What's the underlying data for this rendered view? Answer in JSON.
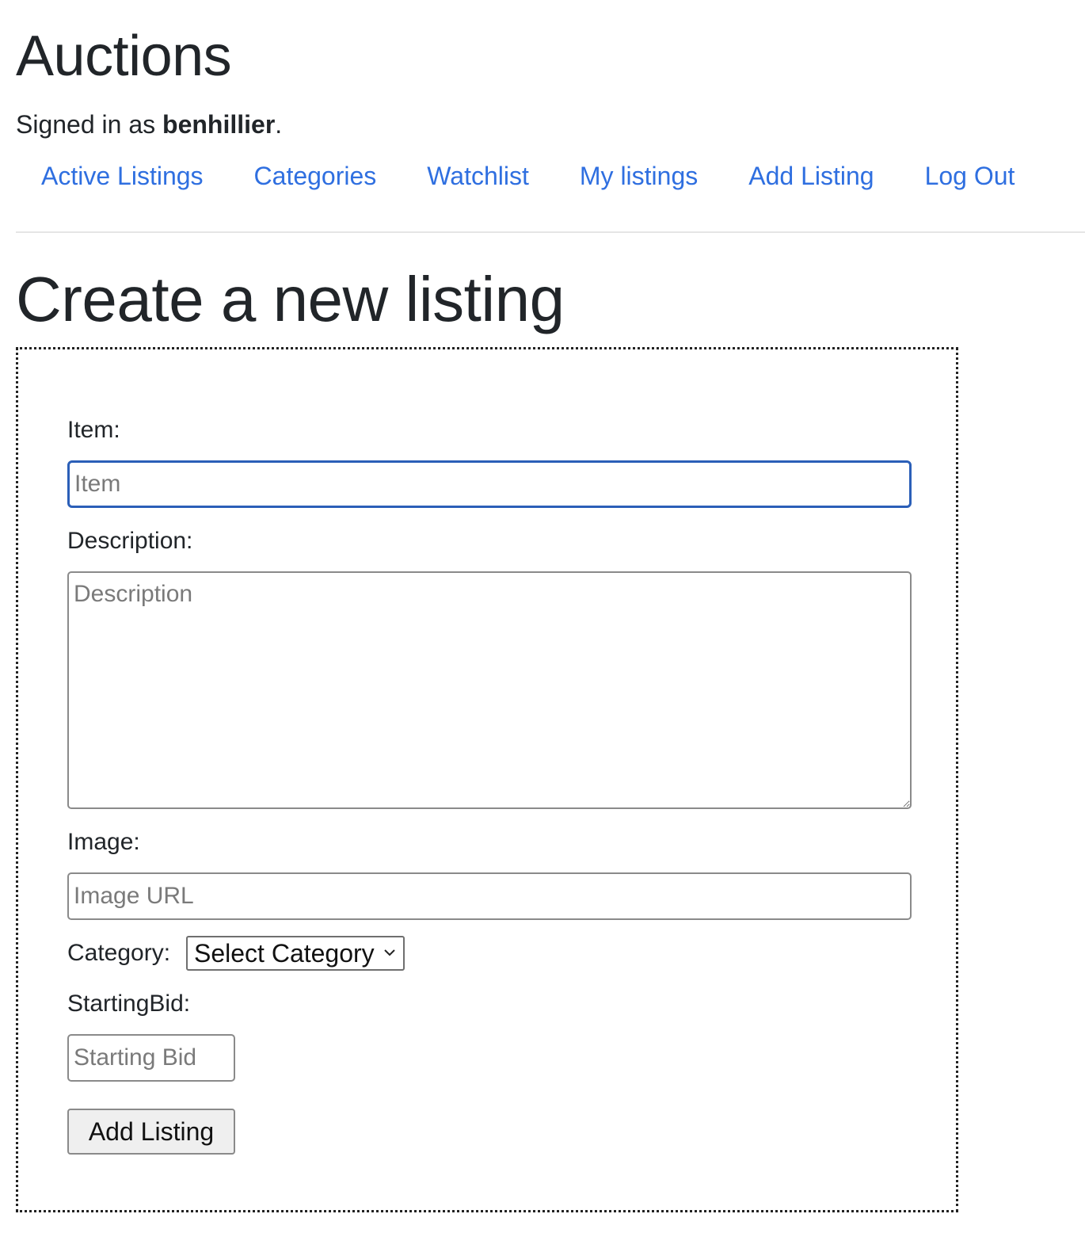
{
  "header": {
    "app_title": "Auctions",
    "signed_in_prefix": "Signed in as ",
    "username": "benhillier",
    "signed_in_suffix": "."
  },
  "nav": {
    "items": [
      {
        "label": "Active Listings"
      },
      {
        "label": "Categories"
      },
      {
        "label": "Watchlist"
      },
      {
        "label": "My listings"
      },
      {
        "label": "Add Listing"
      },
      {
        "label": "Log Out"
      }
    ]
  },
  "main": {
    "page_title": "Create a new listing",
    "form": {
      "item_label": "Item:",
      "item_placeholder": "Item",
      "item_value": "",
      "description_label": "Description:",
      "description_placeholder": "Description",
      "image_label": "Image:",
      "image_placeholder": "Image URL",
      "category_label": "Category:",
      "category_selected": "Select Category",
      "starting_bid_label": "StartingBid:",
      "starting_bid_placeholder": "Starting Bid",
      "submit_label": "Add Listing"
    }
  },
  "colors": {
    "link": "#2f6fe0",
    "focus_border": "#2b5fb8",
    "text": "#212529"
  }
}
